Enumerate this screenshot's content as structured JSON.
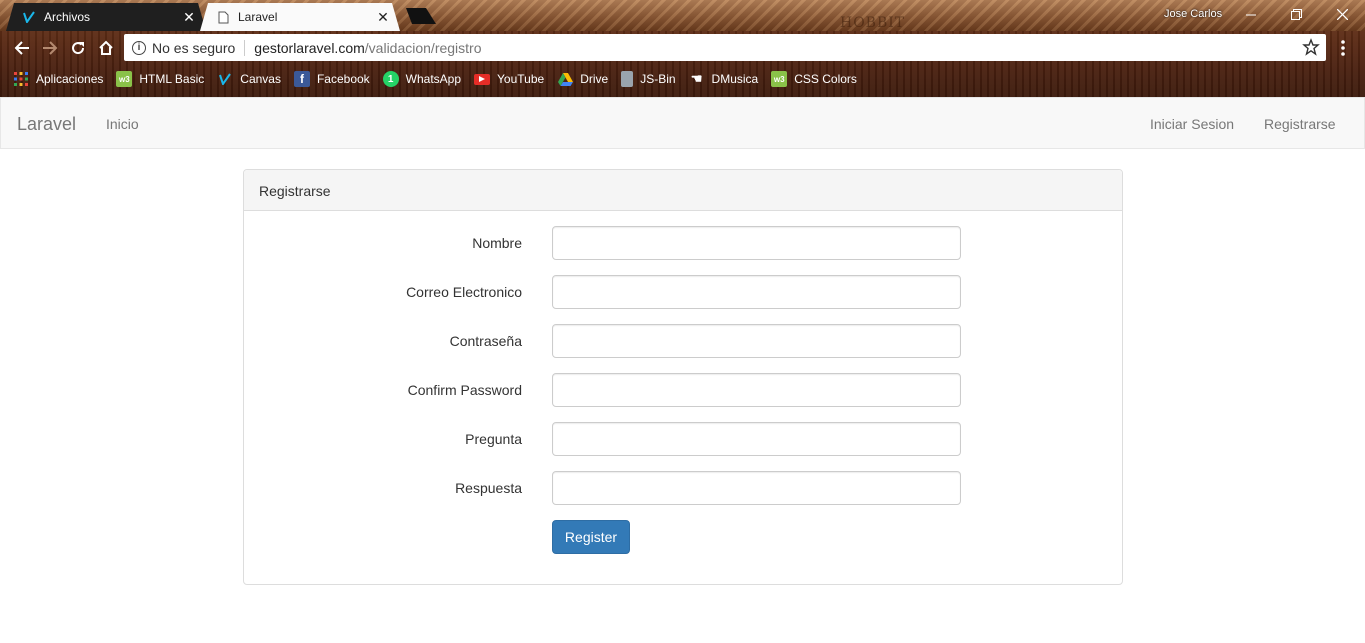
{
  "browser": {
    "tabs": [
      {
        "title": "Archivos",
        "icon": "vimeo-v-icon",
        "active": false
      },
      {
        "title": "Laravel",
        "icon": "page-icon",
        "active": true
      }
    ],
    "watermark": "HOBBIT",
    "user": "Jose Carlos",
    "address": {
      "security_label": "No es seguro",
      "host": "gestorlaravel.com",
      "path": "/validacion/registro"
    },
    "bookmarks": [
      {
        "label": "Aplicaciones",
        "icon": "apps-grid-icon",
        "color": "#e8453c"
      },
      {
        "label": "HTML Basic",
        "icon": "w3-icon",
        "color": "#8ac249"
      },
      {
        "label": "Canvas",
        "icon": "vimeo-v-icon",
        "color": "#1ab7ea"
      },
      {
        "label": "Facebook",
        "icon": "facebook-icon",
        "color": "#3b5998"
      },
      {
        "label": "WhatsApp",
        "icon": "whatsapp-icon",
        "color": "#25d366"
      },
      {
        "label": "YouTube",
        "icon": "youtube-icon",
        "color": "#e52d27"
      },
      {
        "label": "Drive",
        "icon": "drive-icon",
        "color": "#fbbc05"
      },
      {
        "label": "JS-Bin",
        "icon": "jsbin-icon",
        "color": "#9aa4ad"
      },
      {
        "label": "DMusica",
        "icon": "hand-icon",
        "color": "#ffffff"
      },
      {
        "label": "CSS Colors",
        "icon": "w3-icon",
        "color": "#8ac249"
      }
    ]
  },
  "navbar": {
    "brand": "Laravel",
    "links": {
      "home": "Inicio",
      "login": "Iniciar Sesion",
      "register": "Registrarse"
    }
  },
  "panel": {
    "heading": "Registrarse",
    "fields": [
      {
        "label": "Nombre",
        "value": ""
      },
      {
        "label": "Correo Electronico",
        "value": ""
      },
      {
        "label": "Contraseña",
        "value": ""
      },
      {
        "label": "Confirm Password",
        "value": ""
      },
      {
        "label": "Pregunta",
        "value": ""
      },
      {
        "label": "Respuesta",
        "value": ""
      }
    ],
    "submit_label": "Register",
    "accent_color": "#337ab7"
  }
}
